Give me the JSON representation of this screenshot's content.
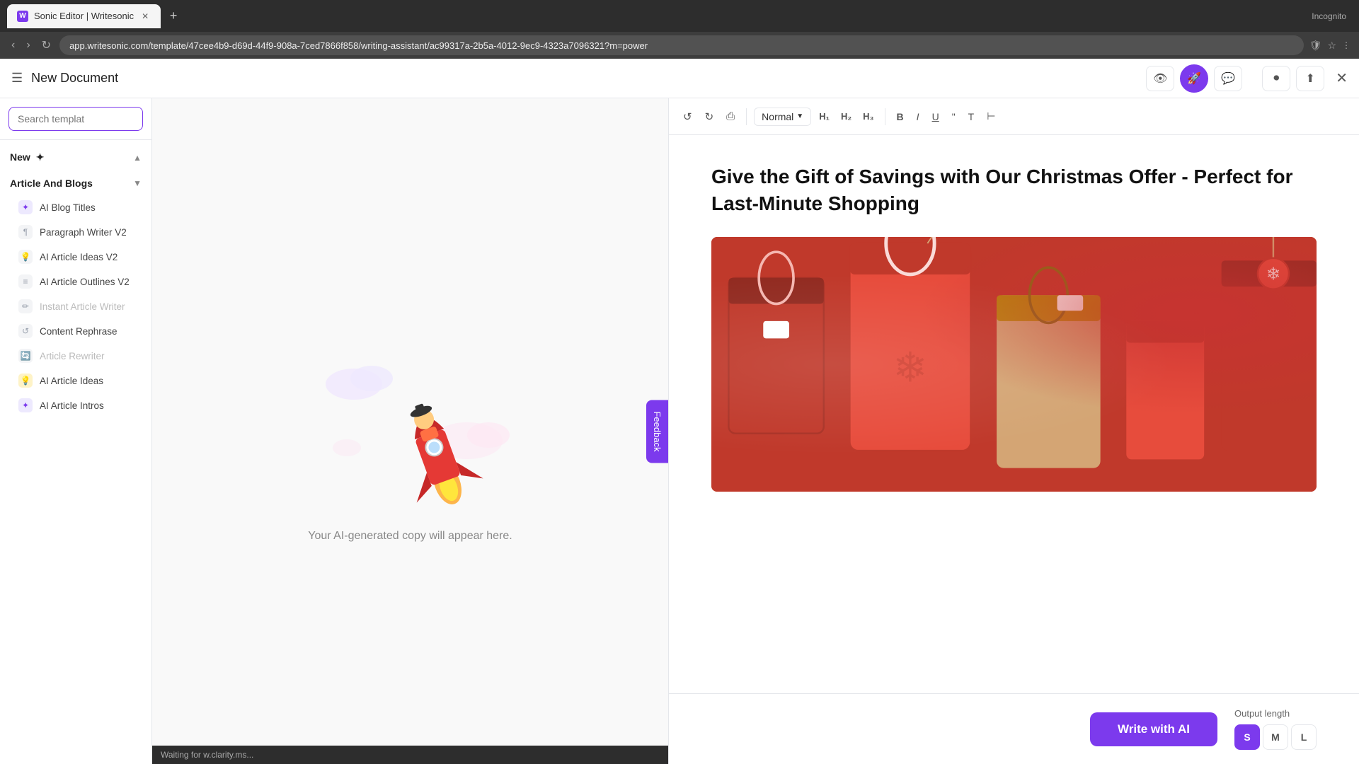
{
  "browser": {
    "tab_title": "Sonic Editor | Writesonic",
    "url": "app.writesonic.com/template/47cee4b9-d69d-44f9-908a-7ced7866f858/writing-assistant/ac99317a-2b5a-4012-9ec9-4323a7096321?m=power",
    "incognito_label": "Incognito"
  },
  "app": {
    "doc_title": "New Document",
    "menu_icon": "☰",
    "close_icon": "✕"
  },
  "toolbar": {
    "undo_label": "↺",
    "redo_label": "↻",
    "print_label": "⎙",
    "style_label": "Normal",
    "h1_label": "H₁",
    "h2_label": "H₂",
    "h3_label": "H₃",
    "bold_label": "B",
    "italic_label": "I",
    "underline_label": "U",
    "quote_label": "❝",
    "font_label": "T",
    "align_label": "⊢"
  },
  "sidebar": {
    "search_placeholder": "Search templat",
    "sections": [
      {
        "id": "new",
        "label": "New",
        "expanded": true,
        "icon": "✦"
      },
      {
        "id": "article-blogs",
        "label": "Article And Blogs",
        "expanded": true
      }
    ],
    "items": [
      {
        "id": "ai-blog-titles",
        "label": "AI Blog Titles",
        "icon_type": "purple",
        "disabled": false
      },
      {
        "id": "paragraph-writer",
        "label": "Paragraph Writer V2",
        "icon_type": "gray",
        "disabled": false
      },
      {
        "id": "ai-article-ideas-v2",
        "label": "AI Article Ideas V2",
        "icon_type": "gray",
        "disabled": false
      },
      {
        "id": "ai-article-outlines",
        "label": "AI Article Outlines V2",
        "icon_type": "gray",
        "disabled": false
      },
      {
        "id": "instant-article-writer",
        "label": "Instant Article Writer",
        "icon_type": "gray",
        "disabled": true
      },
      {
        "id": "content-rephrase",
        "label": "Content Rephrase",
        "icon_type": "gray",
        "disabled": false
      },
      {
        "id": "article-rewriter",
        "label": "Article Rewriter",
        "icon_type": "gray",
        "disabled": true
      },
      {
        "id": "ai-article-ideas",
        "label": "AI Article Ideas",
        "icon_type": "orange",
        "disabled": false
      },
      {
        "id": "ai-article-intros",
        "label": "AI Article Intros",
        "icon_type": "purple",
        "disabled": false
      }
    ]
  },
  "editor": {
    "article_title": "Give the Gift of Savings with Our Christmas Offer - Perfect for Last-Minute Shopping",
    "write_ai_label": "Write with AI",
    "output_length_label": "Output length",
    "length_options": [
      "S",
      "M",
      "L"
    ],
    "active_length": "S"
  },
  "center": {
    "placeholder_text": "Your AI-generated copy will appear here."
  },
  "feedback": {
    "label": "Feedback"
  },
  "status": {
    "text": "Waiting for w.clarity.ms..."
  }
}
